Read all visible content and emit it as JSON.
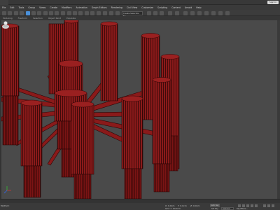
{
  "window": {
    "signin_label": "Sign In"
  },
  "menu": [
    "File",
    "Edit",
    "Tools",
    "Group",
    "Views",
    "Create",
    "Modifiers",
    "Animation",
    "Graph Editors",
    "Rendering",
    "Civil View",
    "Customize",
    "Scripting",
    "Content",
    "Arnold",
    "Help"
  ],
  "toolbar": {
    "view_selector": "Create Selection Se"
  },
  "subbar": [
    "Modeling",
    "Freeform",
    "Selection",
    "Object Paint",
    "Populate"
  ],
  "status": {
    "maxscript": "MAXScri",
    "coord_x": "X: 0.0cm",
    "coord_y": "Y: 0.0cm",
    "coord_z": "Z: 0.0cm",
    "grid": "Grid = 10.0cm",
    "autokey": "Auto Key",
    "selected": "Selected",
    "set_key": "Set Key",
    "key_filters": "Key Filters..."
  },
  "colors": {
    "object": "#8a1a1a",
    "object_edge": "#2b0505",
    "viewport": "#4a4a4a",
    "accent": "#4a90d9"
  }
}
